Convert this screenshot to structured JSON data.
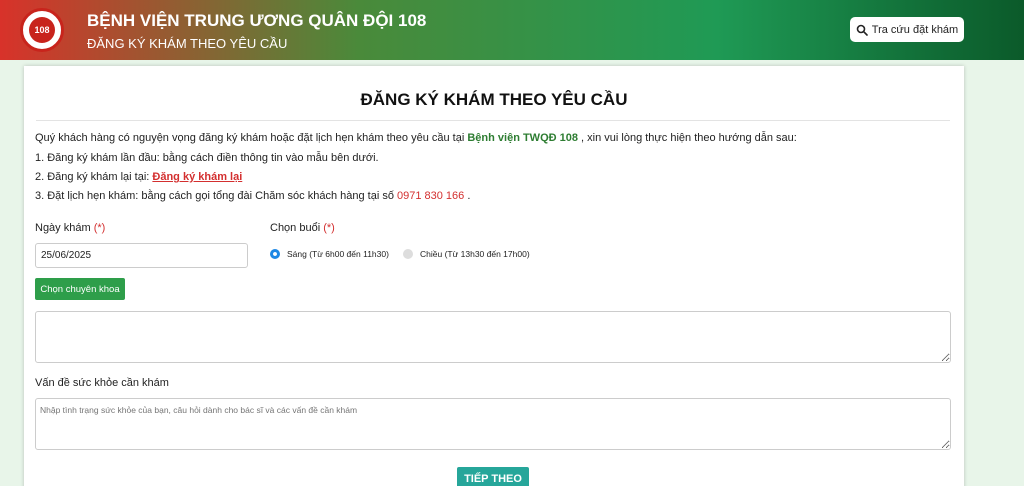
{
  "header": {
    "logo_text": "108",
    "title": "BỆNH VIỆN TRUNG ƯƠNG QUÂN ĐỘI 108",
    "subtitle": "ĐĂNG KÝ KHÁM THEO YÊU CẦU",
    "lookup_label": "Tra cứu đặt khám"
  },
  "card": {
    "title": "ĐĂNG KÝ KHÁM THEO YÊU CẦU",
    "intro": {
      "line1_before": "Quý khách hàng có nguyện vọng đăng ký khám hoặc đặt lịch hẹn khám theo yêu cầu tại ",
      "hospital": "Bệnh viện TWQĐ 108",
      "line1_after": " , xin vui lòng thực hiện theo hướng dẫn sau:",
      "line2": "1. Đăng ký khám lần đầu: bằng cách điền thông tin vào mẫu bên dưới.",
      "line3_before": "2. Đăng ký khám lại tại: ",
      "line3_link": "Đăng ký khám lại",
      "line4_before": "3. Đặt lịch hẹn khám: bằng cách gọi tổng đài Chăm sóc khách hàng tại số ",
      "phone": "0971 830 166",
      "line4_after": " ."
    },
    "form": {
      "date_label": "Ngày khám",
      "required_mark": "(*)",
      "date_value": "25/06/2025",
      "session_label": "Chọn buổi",
      "morning_label": "Sáng (Từ 6h00 đến 11h30)",
      "afternoon_label": "Chiều (Từ 13h30 đến 17h00)",
      "specialty_button": "Chọn chuyên khoa",
      "health_label": "Vấn đề sức khỏe cần khám",
      "health_placeholder": "Nhập tình trạng sức khỏe của bạn, câu hỏi dành cho bác sĩ và các vấn đề cần khám",
      "next_button": "TIẾP THEO"
    }
  }
}
